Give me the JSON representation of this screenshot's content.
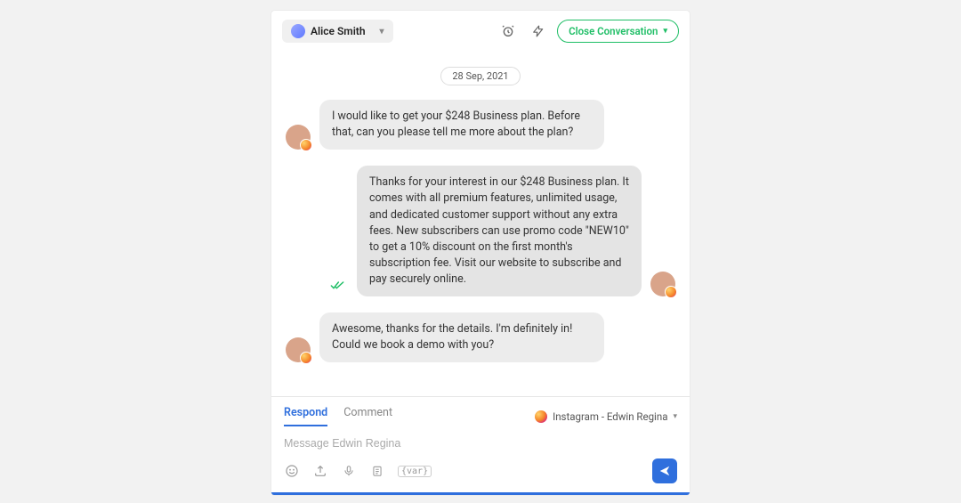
{
  "header": {
    "assignee_name": "Alice Smith",
    "close_label": "Close Conversation"
  },
  "conversation": {
    "date_label": "28 Sep, 2021",
    "messages": [
      {
        "side": "left",
        "text": "I would like to get your $248 Business plan. Before that, can you please tell me more about the plan?"
      },
      {
        "side": "right",
        "text": "Thanks for your interest in our $248 Business plan. It comes with all premium features, unlimited usage, and dedicated customer support without any extra fees. New subscribers can use promo code \"NEW10\" to get a 10% discount on the first month's subscription fee. Visit our website to subscribe and pay securely online.",
        "read": true
      },
      {
        "side": "left",
        "text": "Awesome, thanks for the details. I'm definitely in! Could we book a demo with you?"
      }
    ]
  },
  "composer": {
    "tabs": {
      "respond": "Respond",
      "comment": "Comment",
      "active": "respond"
    },
    "channel_label": "Instagram - Edwin Regina",
    "placeholder": "Message Edwin Regina"
  }
}
